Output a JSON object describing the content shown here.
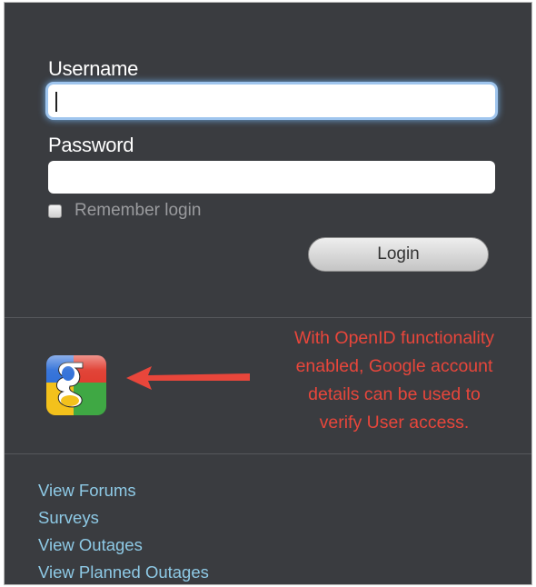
{
  "login": {
    "username_label": "Username",
    "username_value": "",
    "password_label": "Password",
    "password_value": "",
    "remember_label": "Remember login",
    "remember_checked": false,
    "login_button": "Login"
  },
  "openid": {
    "icon": "google-icon",
    "annotation_lines": [
      "With OpenID functionality",
      "enabled, Google account",
      "details can be used to",
      "verify User access."
    ],
    "annotation_color": "#e8463b"
  },
  "links": [
    {
      "label": "View Forums"
    },
    {
      "label": "Surveys"
    },
    {
      "label": "View Outages"
    },
    {
      "label": "View Planned Outages"
    }
  ],
  "colors": {
    "panel_background": "#3a3c40",
    "link": "#8ecae6",
    "focus_glow": "#6fa8e0"
  }
}
